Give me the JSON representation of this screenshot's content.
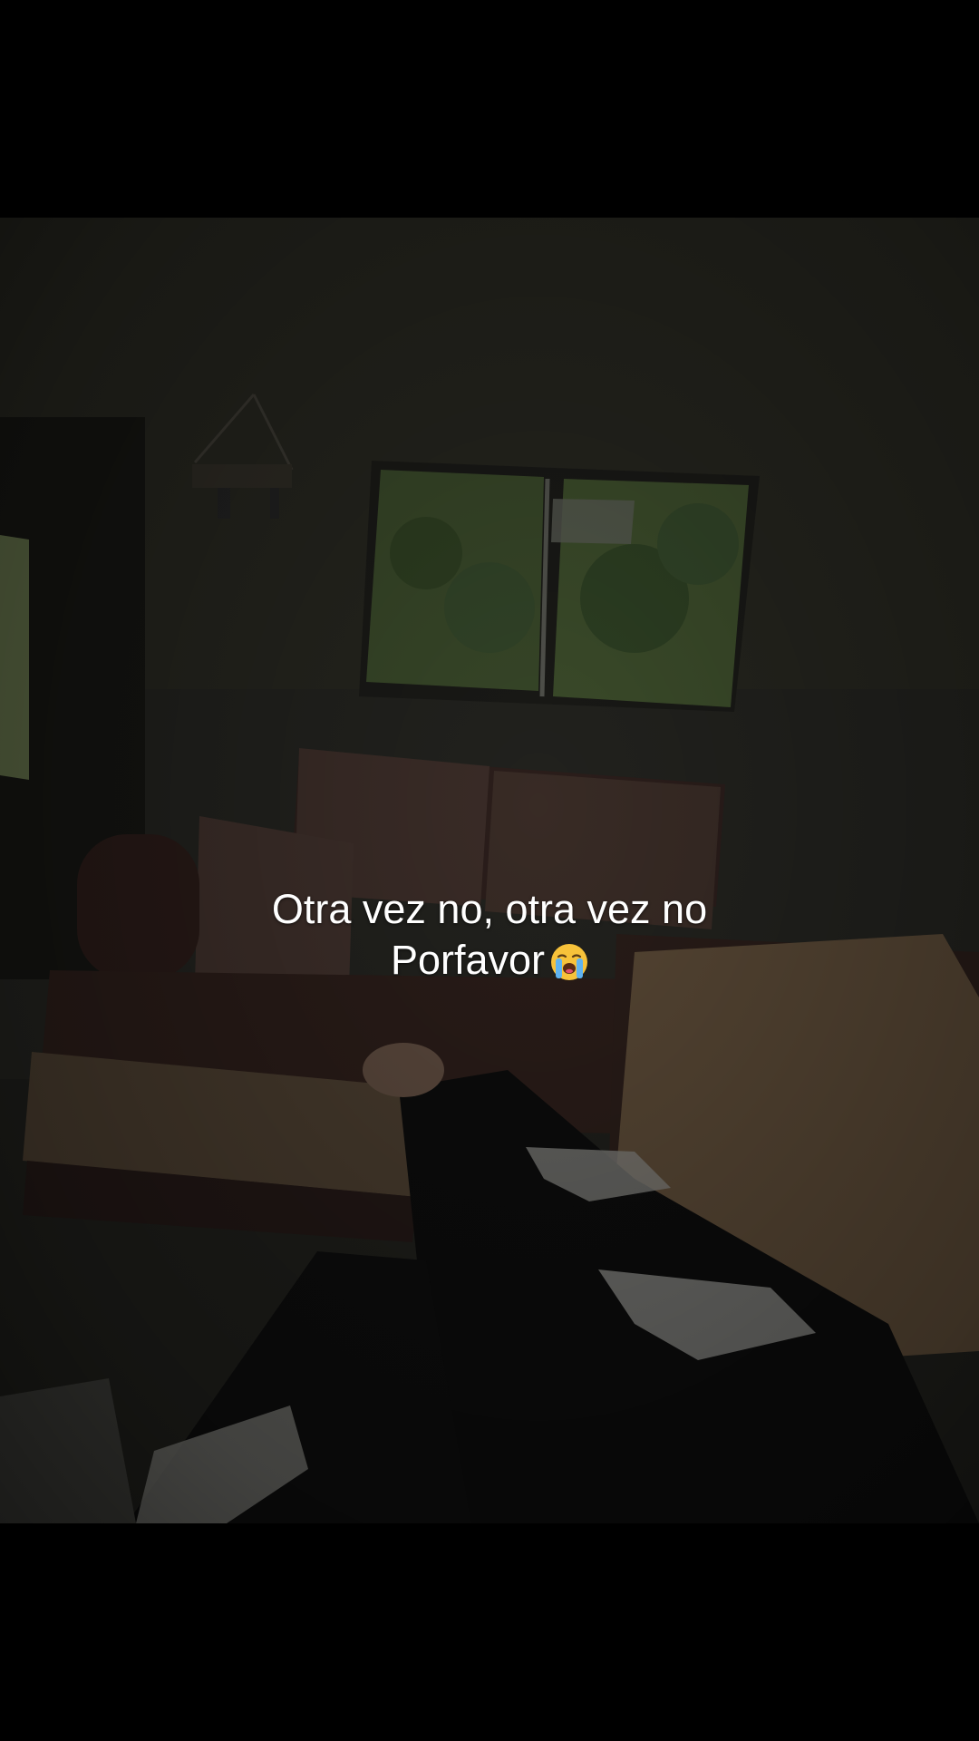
{
  "caption": {
    "line1": "Otra vez no, otra vez no",
    "line2": "Porfavor",
    "emoji": "loudly-crying-face-emoji"
  },
  "scene": "dark living room with window, sofa and legs in foreground"
}
